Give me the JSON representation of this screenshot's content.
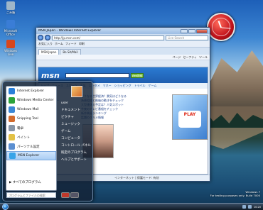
{
  "desktop": {
    "icons": [
      {
        "label": "ごみ箱",
        "color": "#9fb6c9"
      },
      {
        "label": "Microsoft Office",
        "color": "#3a7dd6"
      },
      {
        "label": "Windows Live",
        "color": "#d8461c"
      }
    ]
  },
  "back_window": {
    "title": "Bo Sit/Mail"
  },
  "browser": {
    "title": "MSN Japan - Windows Internet Explorer",
    "url": "http://jp.msn.com/",
    "search_placeholder": "Live Search",
    "toolbar_items": [
      "お気に入り",
      "ホーム",
      "フィード",
      "印刷",
      "ページ",
      "ツール"
    ],
    "tabs": [
      {
        "label": "MSN Japan"
      },
      {
        "label": "Bo Sit/Mail"
      }
    ],
    "cmd": [
      "ページ",
      "セーフティ",
      "ツール"
    ],
    "page": {
      "logo": "msn",
      "search_button": "Web検索",
      "nav": [
        "トップ",
        "ニュース",
        "スポーツ",
        "天気",
        "エンタメ",
        "マネー",
        "ショッピング",
        "トラベル",
        "ゲーム"
      ],
      "left_links": [
        "ホットメール",
        "メッセンジャー",
        "スペース",
        "ニュース",
        "天気",
        "占い",
        "ゲーム",
        "グルメ"
      ],
      "headlines": [
        "どうなる世界経済？景気はどうなる",
        "為替相場と株価の動きをチェック",
        "大型連休の予定は？人気スポット",
        "今夜のテレビ番組をチェック",
        "新作映画ランキング",
        "話題のグルメ情報"
      ],
      "ad_text": "PLAY"
    },
    "status": "インターネット | 保護モード: 有効"
  },
  "start_menu": {
    "programs": [
      {
        "label": "Internet Explorer",
        "color": "#2a7fd9"
      },
      {
        "label": "Windows Media Center",
        "color": "#2ca33b"
      },
      {
        "label": "Windows Mail",
        "color": "#3c88d6"
      },
      {
        "label": "Snipping Tool",
        "color": "#d36b2d"
      },
      {
        "label": "電卓",
        "color": "#8895a6"
      },
      {
        "label": "ペイント",
        "color": "#e2c146"
      },
      {
        "label": "パーソナル設定",
        "color": "#5b8fd1"
      },
      {
        "label": "MSN Explorer",
        "color": "#38a4e8"
      }
    ],
    "all_programs": "すべてのプログラム",
    "search_placeholder": "プログラムとファイルの検索",
    "right_items": [
      "user",
      "ドキュメント",
      "ピクチャ",
      "ミュージック",
      "ゲーム",
      "コンピュータ",
      "コントロール パネル",
      "既定のプログラム",
      "ヘルプとサポート"
    ]
  },
  "watermark": {
    "line1": "Windows 7",
    "line2": "For testing purposes only. Build 7000"
  },
  "taskbar": {
    "time": "10:20"
  }
}
